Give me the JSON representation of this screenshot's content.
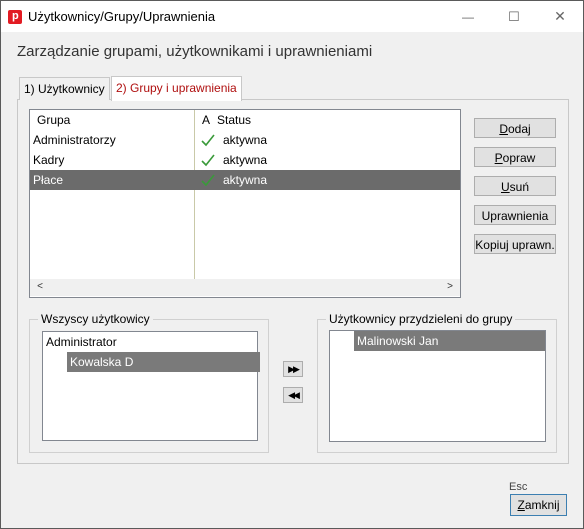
{
  "window": {
    "title": "Użytkownicy/Grupy/Uprawnienia",
    "app_icon_letter": "p",
    "minimize": "—",
    "maximize": "☐",
    "close": "✕"
  },
  "heading": "Zarządzanie grupami, użytkownikami i uprawnieniami",
  "tabs": [
    {
      "label": "1) Użytkownicy",
      "active": false
    },
    {
      "label": "2) Grupy i uprawnienia",
      "active": true
    }
  ],
  "groups_table": {
    "columns": [
      "Grupa",
      "A",
      "Status"
    ],
    "rows": [
      {
        "name": "Administratorzy",
        "active": true,
        "status": "aktywna",
        "selected": false
      },
      {
        "name": "Kadry",
        "active": true,
        "status": "aktywna",
        "selected": false
      },
      {
        "name": "Płace",
        "active": true,
        "status": "aktywna",
        "selected": true
      }
    ],
    "scroll_left": "<",
    "scroll_right": ">"
  },
  "actions": {
    "add_pre": "",
    "add_u": "D",
    "add_post": "odaj",
    "edit_pre": "",
    "edit_u": "P",
    "edit_post": "opraw",
    "delete_pre": "",
    "delete_u": "U",
    "delete_post": "suń",
    "permissions": "Uprawnienia",
    "copy_permissions": "Kopiuj uprawn."
  },
  "all_users": {
    "legend": "Wszyscy użytkowicy",
    "items": [
      {
        "label": "Administrator",
        "selected": false
      },
      {
        "label": "Kowalska D",
        "selected": true
      }
    ]
  },
  "move_buttons": {
    "add": "▶▶",
    "remove": "◀◀"
  },
  "assigned_users": {
    "legend": "Użytkownicy przydzieleni do grupy",
    "items": [
      {
        "label": "Malinowski Jan",
        "selected": true
      }
    ]
  },
  "footer": {
    "esc_hint": "Esc",
    "close_pre": "",
    "close_u": "Z",
    "close_post": "amknij"
  },
  "colors": {
    "selection": "#6b6b6b",
    "active_tab_text": "#b01010",
    "check": "#3a9a3a"
  }
}
